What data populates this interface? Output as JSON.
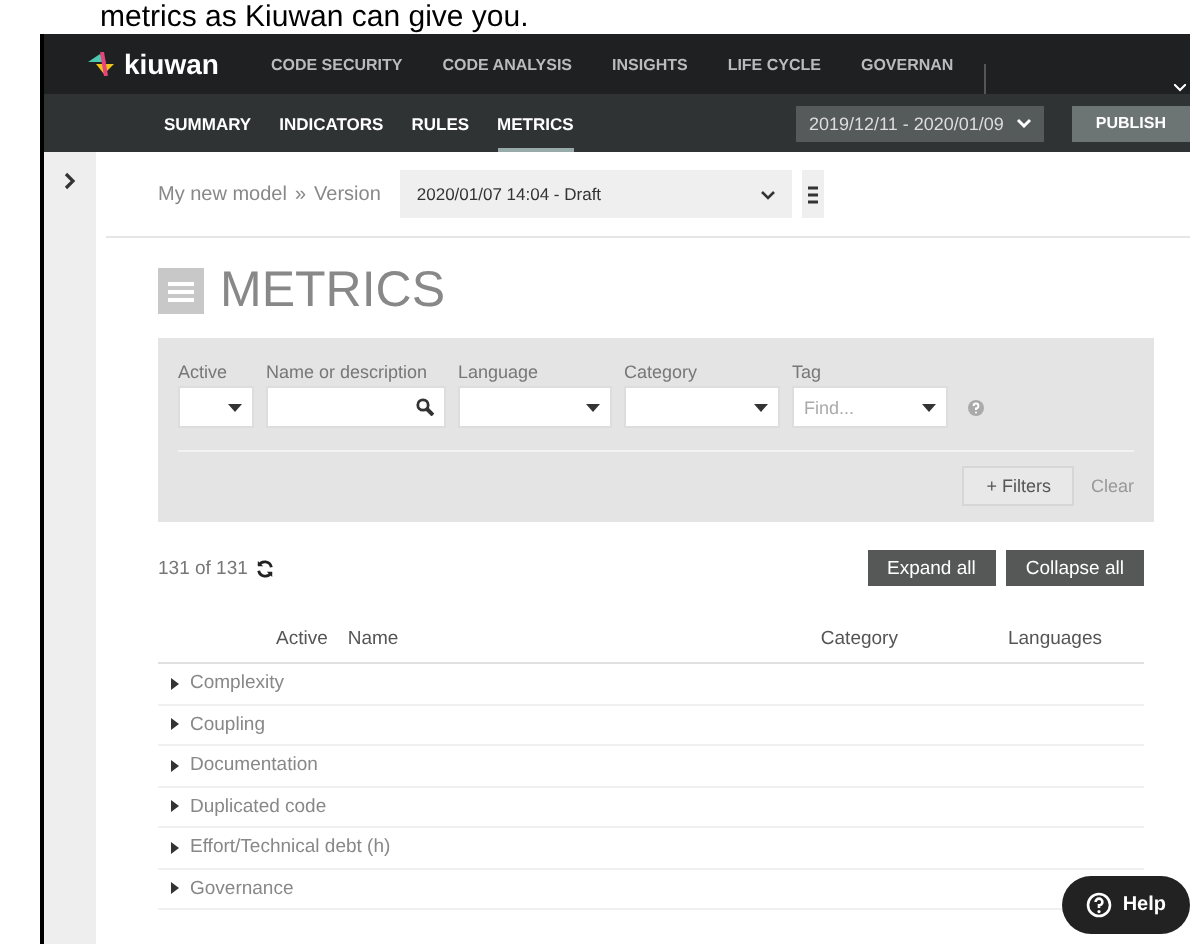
{
  "caption_text": "metrics as Kiuwan can give you.",
  "top_nav": {
    "logo": "kiuwan",
    "items": [
      {
        "label": "CODE SECURITY",
        "selected": false
      },
      {
        "label": "CODE ANALYSIS",
        "selected": false
      },
      {
        "label": "INSIGHTS",
        "selected": false
      },
      {
        "label": "LIFE CYCLE",
        "selected": false
      },
      {
        "label": "GOVERNAN",
        "selected": false
      }
    ]
  },
  "sub_nav": {
    "items": [
      {
        "label": "SUMMARY",
        "selected": false
      },
      {
        "label": "INDICATORS",
        "selected": false
      },
      {
        "label": "RULES",
        "selected": false
      },
      {
        "label": "METRICS",
        "selected": true
      }
    ],
    "date_range": "2019/12/11 - 2020/01/09",
    "publish": "PUBLISH"
  },
  "breadcrumb": {
    "model": "My new model",
    "separator": "»",
    "version_label": "Version",
    "version": "2020/01/07 14:04 - Draft"
  },
  "page_title": "METRICS",
  "filters": {
    "fields": [
      {
        "label": "Active",
        "kind": "select"
      },
      {
        "label": "Name or description",
        "kind": "search"
      },
      {
        "label": "Language",
        "kind": "select"
      },
      {
        "label": "Category",
        "kind": "select"
      },
      {
        "label": "Tag",
        "kind": "select",
        "placeholder": "Find..."
      }
    ],
    "more_filters": "+ Filters",
    "clear": "Clear"
  },
  "results": {
    "count": "131 of 131",
    "expand_all": "Expand all",
    "collapse_all": "Collapse all"
  },
  "table": {
    "columns": [
      "Active",
      "Name",
      "Category",
      "Languages"
    ],
    "rows": [
      {
        "name": "Complexity",
        "expanded": false
      },
      {
        "name": "Coupling",
        "expanded": false
      },
      {
        "name": "Documentation",
        "expanded": false
      },
      {
        "name": "Duplicated code",
        "expanded": false
      },
      {
        "name": "Effort/Technical debt (h)",
        "expanded": false
      },
      {
        "name": "Governance",
        "expanded": false
      }
    ]
  },
  "help_button": "Help"
}
